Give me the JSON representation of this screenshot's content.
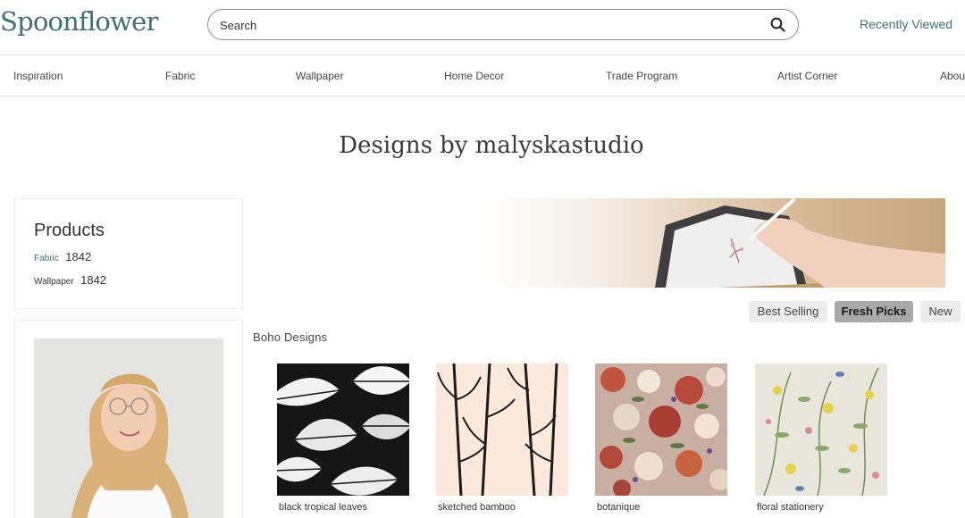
{
  "header": {
    "logo": "Spoonflower",
    "search_placeholder": "Search",
    "recently_viewed": "Recently Viewed"
  },
  "nav": [
    "Inspiration",
    "Fabric",
    "Wallpaper",
    "Home Decor",
    "Trade Program",
    "Artist Corner",
    "About"
  ],
  "page_title": "Designs by malyskastudio",
  "products": {
    "title": "Products",
    "items": [
      {
        "label": "Fabric",
        "count": "1842"
      },
      {
        "label": "Wallpaper",
        "count": "1842"
      }
    ]
  },
  "sort_tabs": [
    {
      "label": "Best Selling",
      "active": false
    },
    {
      "label": "Fresh Picks",
      "active": true
    },
    {
      "label": "New",
      "active": false
    }
  ],
  "section": {
    "title": "Boho Designs"
  },
  "designs": [
    {
      "name": "black tropical leaves",
      "swatch": "leaf-pattern"
    },
    {
      "name": "sketched bamboo",
      "swatch": "bamboo-pattern"
    },
    {
      "name": "botanique",
      "swatch": "floral-pattern"
    },
    {
      "name": "floral stationery",
      "swatch": "light-floral-pattern"
    }
  ],
  "colors": {
    "brand": "#3e7074",
    "active_tab_bg": "#a9a9a9",
    "inactive_tab_bg": "#ececec",
    "fabric_link": "#3e7074",
    "wallpaper_link": "#333333"
  }
}
